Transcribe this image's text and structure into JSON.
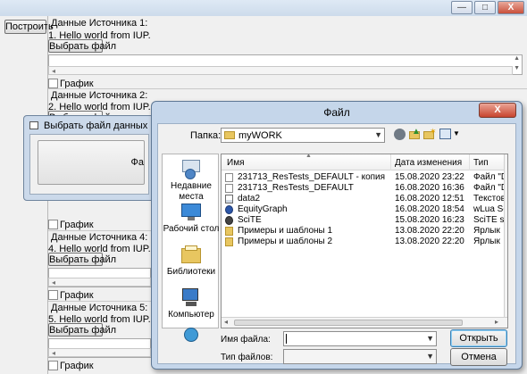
{
  "main": {
    "build_button": "Построить",
    "win_buttons": {
      "minimize": "—",
      "maximize": "□",
      "close": "X"
    },
    "sources": [
      {
        "header": "Данные Источника 1:",
        "line": "1. Hello world from IUP.",
        "select_button": "Выбрать файл",
        "chart_label": "График"
      },
      {
        "header": "Данные Источника 2:",
        "line": "2. Hello world from IUP.",
        "select_button": "Выбрать файл",
        "chart_label": "График"
      },
      {
        "header": "Данные Источника 4:",
        "line": "4. Hello world from IUP.",
        "select_button": "Выбрать файл",
        "chart_label": "График"
      },
      {
        "header": "Данные Источника 5:",
        "line": "5. Hello world from IUP.",
        "select_button": "Выбрать файл",
        "chart_label": "График"
      }
    ],
    "partial_chart_label": "График"
  },
  "small_dialog": {
    "title": "Выбрать файл данных",
    "button_fragment": "Фа"
  },
  "file_dialog": {
    "title": "Файл",
    "close": "X",
    "folder_label": "Папка:",
    "folder_value": "myWORK",
    "places": [
      {
        "label": "Недавние места",
        "icon": "recent-places-icon"
      },
      {
        "label": "Рабочий стол",
        "icon": "desktop-icon"
      },
      {
        "label": "Библиотеки",
        "icon": "libraries-icon"
      },
      {
        "label": "Компьютер",
        "icon": "computer-icon"
      },
      {
        "label": "",
        "icon": "network-icon"
      }
    ],
    "columns": {
      "name": "Имя",
      "date": "Дата изменения",
      "type": "Тип"
    },
    "files": [
      {
        "name": "231713_ResTests_DEFAULT - копия",
        "date": "15.08.2020 23:22",
        "type": "Файл \"DA",
        "icon": "file-icon"
      },
      {
        "name": "231713_ResTests_DEFAULT",
        "date": "16.08.2020 16:36",
        "type": "Файл \"DA",
        "icon": "file-icon"
      },
      {
        "name": "data2",
        "date": "16.08.2020 12:51",
        "type": "Текстовы",
        "icon": "text-file-icon"
      },
      {
        "name": "EquityGraph",
        "date": "16.08.2020 18:54",
        "type": "wLua Scrip",
        "icon": "lua-script-icon"
      },
      {
        "name": "SciTE",
        "date": "15.08.2020 16:23",
        "type": "SciTE sess",
        "icon": "scite-icon"
      },
      {
        "name": "Примеры и шаблоны 1",
        "date": "13.08.2020 22:20",
        "type": "Ярлык",
        "icon": "shortcut-icon"
      },
      {
        "name": "Примеры и шаблоны 2",
        "date": "13.08.2020 22:20",
        "type": "Ярлык",
        "icon": "shortcut-icon"
      }
    ],
    "filename_label": "Имя файла:",
    "filename_value": "",
    "filetype_label": "Тип файлов:",
    "filetype_value": "",
    "open_button": "Открыть",
    "cancel_button": "Отмена"
  },
  "colors": {
    "accent": "#3c7fb1",
    "close_red": "#c7442f",
    "title_bar": "#c5d6ea"
  }
}
